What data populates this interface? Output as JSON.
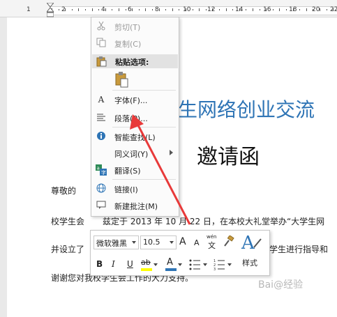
{
  "ruler": {
    "numbers": [
      "1",
      "2",
      "4",
      "6",
      "8",
      "10",
      "12",
      "14",
      "16",
      "18",
      "20",
      "22"
    ]
  },
  "document": {
    "title_partial": "生网络创业交流",
    "subtitle": "邀请函",
    "greeting": "尊敬的",
    "line1_partial": "校学生会",
    "line1_rest": "兹定于 2013 年 10 月 22 日，在本校大礼堂举办“大学生网",
    "line2_prefix": "并设立了",
    "line2_suffix": "学生进行指导和",
    "line3": "谢谢您对我校学生会工作的大力支持。"
  },
  "context_menu": {
    "items": [
      {
        "label": "剪切(T)",
        "icon": "scissors-icon",
        "enabled": false
      },
      {
        "label": "复制(C)",
        "icon": "copy-icon",
        "enabled": false
      },
      {
        "label": "粘贴选项:",
        "icon": "clipboard-icon",
        "enabled": true
      },
      {
        "label": "字体(F)...",
        "icon": "font-icon",
        "enabled": true
      },
      {
        "label": "段落(P)...",
        "icon": "paragraph-icon",
        "enabled": true
      },
      {
        "label": "智能查找(L)",
        "icon": "smart-lookup-icon",
        "enabled": true
      },
      {
        "label": "同义词(Y)",
        "icon": "",
        "enabled": true,
        "submenu": true
      },
      {
        "label": "翻译(S)",
        "icon": "translate-icon",
        "enabled": true
      },
      {
        "label": "链接(I)",
        "icon": "link-icon",
        "enabled": true
      },
      {
        "label": "新建批注(M)",
        "icon": "comment-icon",
        "enabled": true
      }
    ]
  },
  "mini_toolbar": {
    "font_name": "微软雅黑",
    "font_size": "10.5",
    "grow_font": "A",
    "shrink_font": "A",
    "phonetic": "wén",
    "phonetic_char": "文",
    "bold": "B",
    "italic": "I",
    "underline": "U",
    "highlight": "ab",
    "font_color": "A",
    "styles_label": "样式"
  },
  "watermark": "Bai@经验"
}
